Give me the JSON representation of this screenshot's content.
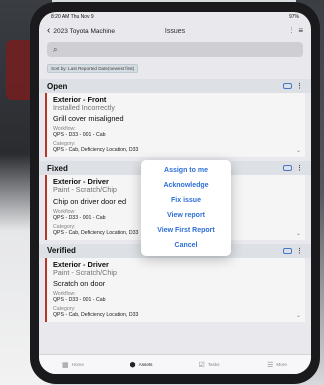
{
  "status": {
    "time": "8:20 AM  Thu Nov 9",
    "battery": "97%"
  },
  "nav": {
    "back_label": "2023 Toyota Machine",
    "title": "Issues"
  },
  "sort_label": "Sort by: Last Reported Date(newest first)",
  "sections": [
    {
      "title": "Open",
      "card": {
        "title": "Exterior - Front",
        "subtitle": "Installed Incorrectly",
        "description": "Grill cover misaligned",
        "workflow_label": "Workflow:",
        "workflow": "QPS - D33 - 001 - Cab",
        "category_label": "Category:",
        "category": "QPS - Cab, Deficiency Location, D33"
      }
    },
    {
      "title": "Fixed",
      "card": {
        "title": "Exterior - Driver",
        "subtitle": "Paint - Scratch/Chip",
        "description": "Chip on driver door ed",
        "workflow_label": "Workflow:",
        "workflow": "QPS - D33 - 001 - Cab",
        "category_label": "Category:",
        "category": "QPS - Cab, Deficiency Location, D33"
      }
    },
    {
      "title": "Verified",
      "card": {
        "title": "Exterior - Driver",
        "subtitle": "Paint - Scratch/Chip",
        "description": "Scratch on door",
        "workflow_label": "Workflow:",
        "workflow": "QPS - D33 - 001 - Cab",
        "category_label": "Category:",
        "category": "QPS - Cab, Deficiency Location, D33"
      }
    }
  ],
  "menu": [
    "Assign to me",
    "Acknowledge",
    "Fix issue",
    "View report",
    "View First Report",
    "Cancel"
  ],
  "tabs": [
    {
      "label": "Home",
      "icon": "home-icon"
    },
    {
      "label": "Assets",
      "icon": "assets-icon"
    },
    {
      "label": "Tasks",
      "icon": "tasks-icon"
    },
    {
      "label": "More",
      "icon": "more-icon"
    }
  ],
  "colors": {
    "accent": "#2f6fd6",
    "status_bar": "#c0392b"
  }
}
